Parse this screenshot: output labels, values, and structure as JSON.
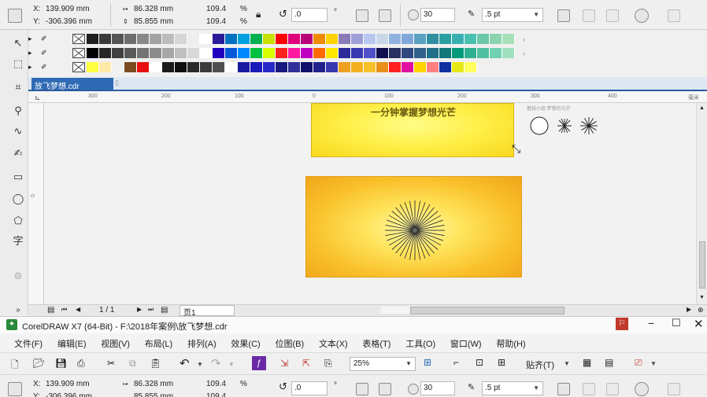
{
  "property_bar": {
    "x_label": "X:",
    "x_value": "139.909 mm",
    "y_label": "Y:",
    "y_value": "-306.396 mm",
    "width_value": "86.328 mm",
    "height_value": "85.855 mm",
    "scale_x": "109.4",
    "scale_y": "109.4",
    "percent_x": "%",
    "percent_y": "%",
    "rotation_value": ".0",
    "degree_symbol": "°",
    "points_value": "30",
    "outline_width": ".5 pt"
  },
  "document": {
    "tab_label": "放飞梦想.cdr"
  },
  "ruler": {
    "h_ticks": [
      "300",
      "200",
      "100",
      "0",
      "100",
      "200",
      "300",
      "400"
    ],
    "v_tick": "0",
    "unit": "毫米"
  },
  "canvas": {
    "top_banner_text": "一分钟掌握梦想光芒",
    "small_caption": "基线小组 梦想的光芒"
  },
  "page_nav": {
    "page_counter": "1 / 1",
    "page_tab": "页1"
  },
  "window": {
    "title": "CorelDRAW X7 (64-Bit) - F:\\2018年案例\\放飞梦想.cdr"
  },
  "menu": {
    "items": [
      "文件(F)",
      "编辑(E)",
      "视图(V)",
      "布局(L)",
      "排列(A)",
      "效果(C)",
      "位图(B)",
      "文本(X)",
      "表格(T)",
      "工具(O)",
      "窗口(W)",
      "帮助(H)"
    ]
  },
  "standard_toolbar": {
    "zoom_value": "25%",
    "snap_label": "贴齐(T)"
  },
  "palette": {
    "row1": [
      "#1e1e1e",
      "#3a3a3a",
      "#555555",
      "#6e6e6e",
      "#888888",
      "#a2a2a2",
      "#bcbcbc",
      "#d6d6d6",
      "#eeeeee",
      "#ffffff",
      "#2a1b99",
      "#0070c0",
      "#00a0e0",
      "#00b050",
      "#c8e000",
      "#ff0000",
      "#e0007a",
      "#b8007a",
      "#f08a00",
      "#ffd200",
      "#8a7ab8",
      "#a0a0d8",
      "#b8c8f0",
      "#c8d8e8",
      "#90b0e0",
      "#7fa8d8",
      "#5aa0c0",
      "#2f8fa0",
      "#2aa0a0",
      "#38b0b0",
      "#48c0b0",
      "#6cc8a8",
      "#8ad4b0",
      "#a8e0b8"
    ],
    "row2": [
      "#000000",
      "#262626",
      "#404040",
      "#5a5a5a",
      "#737373",
      "#8c8c8c",
      "#a6a6a6",
      "#bfbfbf",
      "#d9d9d9",
      "#ffffff",
      "#2000c0",
      "#005ad8",
      "#0088ff",
      "#00c040",
      "#d8ff00",
      "#ff2020",
      "#ff1aa0",
      "#c000c0",
      "#ff6a00",
      "#ffe800",
      "#2a2a9a",
      "#3838b0",
      "#5050c8",
      "#101050",
      "#283060",
      "#304880",
      "#30608a",
      "#20708a",
      "#107878",
      "#009a7a",
      "#30b090",
      "#50c0a0",
      "#70d0b0",
      "#a0e0c0"
    ],
    "row3": [
      "#ffff40",
      "#ffe8a8",
      "#f0f0f0",
      "#7a4a20",
      "#e81010",
      "#ffffff",
      "#1a1a1a",
      "#101010",
      "#2a2a2a",
      "#3a3a3a",
      "#505050",
      "#ffffff",
      "#1a1aa0",
      "#1a1ab8",
      "#2828c8",
      "#181880",
      "#303098",
      "#10106a",
      "#20208a",
      "#3838b0",
      "#f0a020",
      "#f4b020",
      "#f6c028",
      "#e89018",
      "#ff2020",
      "#e010a0",
      "#ffd400",
      "#ff8080",
      "#1030a0",
      "#e8e818",
      "#ffff60"
    ]
  }
}
